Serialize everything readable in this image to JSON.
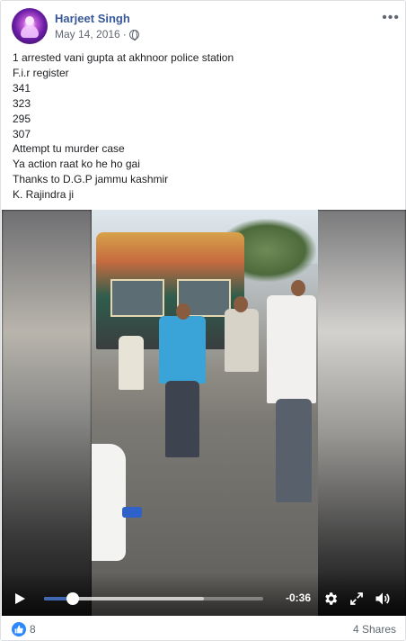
{
  "post": {
    "author": "Harjeet Singh",
    "date": "May 14, 2016",
    "privacy_icon": "globe-icon",
    "more_icon": "more-options-icon",
    "text_lines": [
      "1 arrested vani gupta at akhnoor police station",
      "F.i.r register",
      "341",
      "323",
      "295",
      "307",
      "Attempt tu murder case",
      "Ya action raat ko he ho gai",
      "Thanks to D.G.P jammu kashmir",
      "K. Rajindra ji"
    ]
  },
  "video": {
    "time_remaining": "-0:36",
    "progress_fraction": 0.13,
    "buffered_fraction": 0.73,
    "play_icon": "play-icon",
    "settings_icon": "gear-icon",
    "fullscreen_icon": "expand-icon",
    "volume_icon": "volume-icon"
  },
  "footer": {
    "like_count": "8",
    "shares": "4 Shares",
    "like_icon": "thumbs-up-icon"
  },
  "colors": {
    "link": "#385898",
    "muted": "#616770",
    "like_blue": "#2d88ff",
    "progress": "#4267b2"
  }
}
